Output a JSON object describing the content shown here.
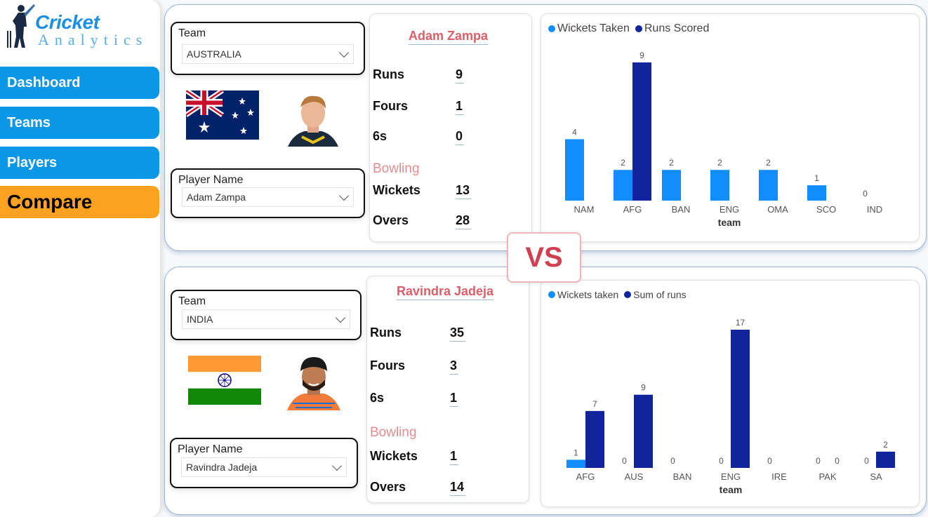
{
  "logo": {
    "line1": "Cricket",
    "line2": "Analytics"
  },
  "nav": [
    {
      "label": "Dashboard"
    },
    {
      "label": "Teams"
    },
    {
      "label": "Players"
    },
    {
      "label": "Compare"
    }
  ],
  "vs_label": "VS",
  "player1": {
    "team_label": "Team",
    "team_value": "AUSTRALIA",
    "player_label": "Player Name",
    "player_value": "Adam Zampa",
    "name": "Adam Zampa",
    "stats": {
      "runs_label": "Runs",
      "runs": "9",
      "fours_label": "Fours",
      "fours": "1",
      "sixes_label": "6s",
      "sixes": "0",
      "bowling_label": "Bowling",
      "wickets_label": "Wickets",
      "wickets": "13",
      "overs_label": "Overs",
      "overs": "28"
    },
    "legend": [
      "Wickets Taken",
      "Runs Scored"
    ],
    "xlabel": "team"
  },
  "player2": {
    "team_label": "Team",
    "team_value": "INDIA",
    "player_label": "Player Name",
    "player_value": "Ravindra Jadeja",
    "name": "Ravindra Jadeja",
    "stats": {
      "runs_label": "Runs",
      "runs": "35",
      "fours_label": "Fours",
      "fours": "3",
      "sixes_label": "6s",
      "sixes": "1",
      "bowling_label": "Bowling",
      "wickets_label": "Wickets",
      "wickets": "1",
      "overs_label": "Overs",
      "overs": "14"
    },
    "legend": [
      "Wickets taken",
      "Sum of runs"
    ],
    "xlabel": "team"
  },
  "colors": {
    "light": "#118dff",
    "dark": "#12239e",
    "accent": "#fca121",
    "nav": "#0a97e8"
  },
  "chart_data": [
    {
      "type": "bar",
      "categories": [
        "NAM",
        "AFG",
        "BAN",
        "ENG",
        "OMA",
        "SCO",
        "IND"
      ],
      "series": [
        {
          "name": "Wickets Taken",
          "values": [
            4,
            2,
            2,
            2,
            2,
            1,
            0
          ]
        },
        {
          "name": "Runs Scored",
          "values": [
            null,
            9,
            null,
            null,
            null,
            null,
            null
          ]
        }
      ],
      "xlabel": "team",
      "ylim": [
        0,
        9
      ]
    },
    {
      "type": "bar",
      "categories": [
        "AFG",
        "AUS",
        "BAN",
        "ENG",
        "IRE",
        "PAK",
        "SA"
      ],
      "series": [
        {
          "name": "Wickets taken",
          "values": [
            1,
            0,
            0,
            0,
            0,
            0,
            0
          ]
        },
        {
          "name": "Sum of runs",
          "values": [
            7,
            9,
            null,
            17,
            null,
            0,
            2
          ]
        }
      ],
      "xlabel": "team",
      "ylim": [
        0,
        17
      ]
    }
  ]
}
